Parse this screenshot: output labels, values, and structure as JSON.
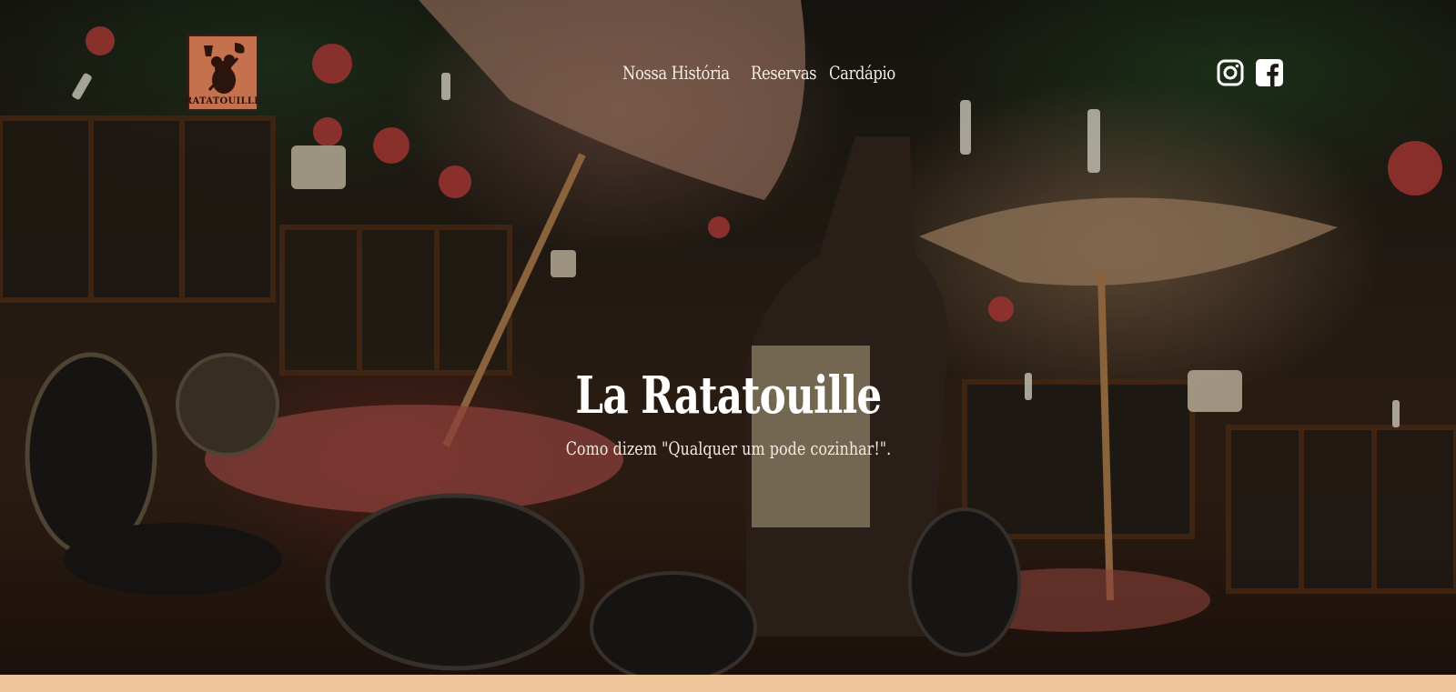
{
  "brand": {
    "logo_text": "RATATOUILLE",
    "logo_color": "#c6714e"
  },
  "nav": {
    "items": [
      {
        "label": "Nossa História"
      },
      {
        "label": "Reservas"
      },
      {
        "label": "Cardápio"
      }
    ]
  },
  "social": {
    "icons": [
      "instagram-icon",
      "facebook-icon"
    ]
  },
  "hero": {
    "title": "La Ratatouille",
    "subtitle": "Como dizem \"Qualquer um pode cozinhar!\"."
  },
  "colors": {
    "band": "#efc59c",
    "text": "#ffffff"
  }
}
